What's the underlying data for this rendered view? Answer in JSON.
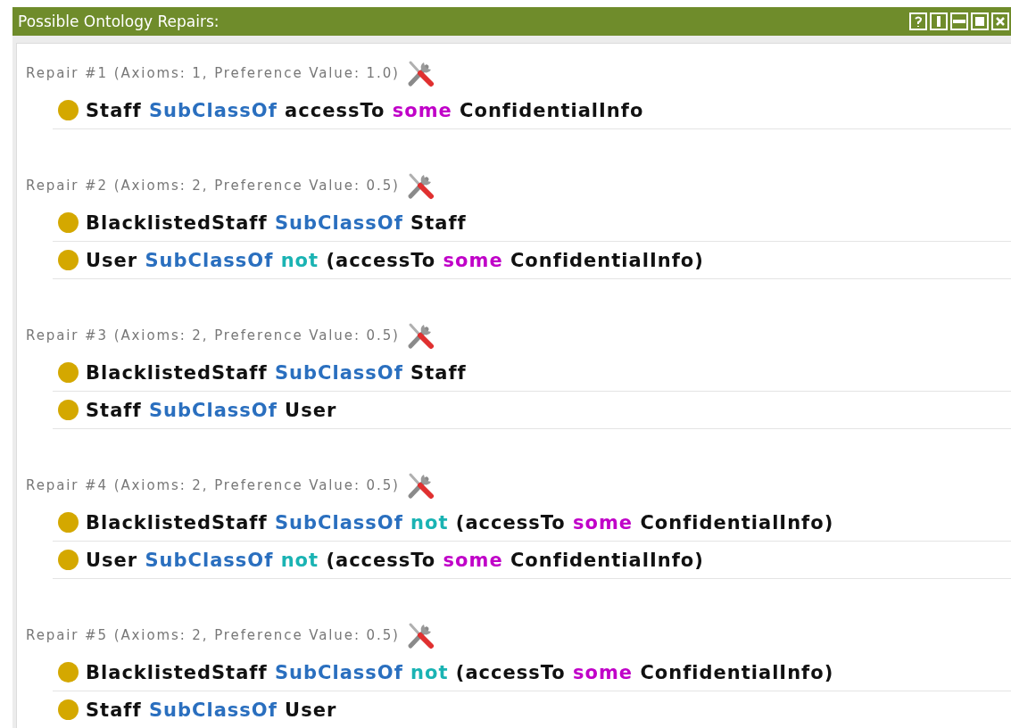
{
  "window": {
    "title": "Possible Ontology Repairs:"
  },
  "repairs": [
    {
      "header": "Repair #1 (Axioms: 1, Preference Value: 1.0)",
      "axioms": [
        [
          {
            "kind": "name",
            "text": "Staff"
          },
          {
            "kind": "keyword",
            "text": "SubClassOf"
          },
          {
            "kind": "name",
            "text": "accessTo"
          },
          {
            "kind": "quantifier",
            "text": "some"
          },
          {
            "kind": "name",
            "text": "ConfidentialInfo"
          }
        ]
      ]
    },
    {
      "header": "Repair #2 (Axioms: 2, Preference Value: 0.5)",
      "axioms": [
        [
          {
            "kind": "name",
            "text": "BlacklistedStaff"
          },
          {
            "kind": "keyword",
            "text": "SubClassOf"
          },
          {
            "kind": "name",
            "text": "Staff"
          }
        ],
        [
          {
            "kind": "name",
            "text": "User"
          },
          {
            "kind": "keyword",
            "text": "SubClassOf"
          },
          {
            "kind": "negation",
            "text": "not"
          },
          {
            "kind": "name",
            "text": "(accessTo"
          },
          {
            "kind": "quantifier",
            "text": "some"
          },
          {
            "kind": "name",
            "text": "ConfidentialInfo)"
          }
        ]
      ]
    },
    {
      "header": "Repair #3 (Axioms: 2, Preference Value: 0.5)",
      "axioms": [
        [
          {
            "kind": "name",
            "text": "BlacklistedStaff"
          },
          {
            "kind": "keyword",
            "text": "SubClassOf"
          },
          {
            "kind": "name",
            "text": "Staff"
          }
        ],
        [
          {
            "kind": "name",
            "text": "Staff"
          },
          {
            "kind": "keyword",
            "text": "SubClassOf"
          },
          {
            "kind": "name",
            "text": "User"
          }
        ]
      ]
    },
    {
      "header": "Repair #4 (Axioms: 2, Preference Value: 0.5)",
      "axioms": [
        [
          {
            "kind": "name",
            "text": "BlacklistedStaff"
          },
          {
            "kind": "keyword",
            "text": "SubClassOf"
          },
          {
            "kind": "negation",
            "text": "not"
          },
          {
            "kind": "name",
            "text": "(accessTo"
          },
          {
            "kind": "quantifier",
            "text": "some"
          },
          {
            "kind": "name",
            "text": "ConfidentialInfo)"
          }
        ],
        [
          {
            "kind": "name",
            "text": "User"
          },
          {
            "kind": "keyword",
            "text": "SubClassOf"
          },
          {
            "kind": "negation",
            "text": "not"
          },
          {
            "kind": "name",
            "text": "(accessTo"
          },
          {
            "kind": "quantifier",
            "text": "some"
          },
          {
            "kind": "name",
            "text": "ConfidentialInfo)"
          }
        ]
      ]
    },
    {
      "header": "Repair #5 (Axioms: 2, Preference Value: 0.5)",
      "axioms": [
        [
          {
            "kind": "name",
            "text": "BlacklistedStaff"
          },
          {
            "kind": "keyword",
            "text": "SubClassOf"
          },
          {
            "kind": "negation",
            "text": "not"
          },
          {
            "kind": "name",
            "text": "(accessTo"
          },
          {
            "kind": "quantifier",
            "text": "some"
          },
          {
            "kind": "name",
            "text": "ConfidentialInfo)"
          }
        ],
        [
          {
            "kind": "name",
            "text": "Staff"
          },
          {
            "kind": "keyword",
            "text": "SubClassOf"
          },
          {
            "kind": "name",
            "text": "User"
          }
        ]
      ]
    }
  ]
}
